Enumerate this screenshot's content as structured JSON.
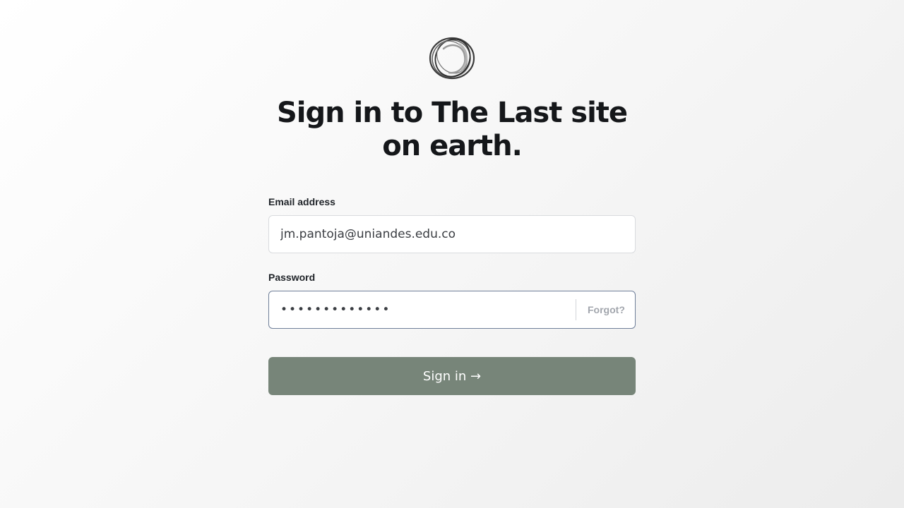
{
  "title": "Sign in to The Last site on earth.",
  "logo_icon": "ring-logo-icon",
  "form": {
    "email_label": "Email address",
    "email_value": "jm.pantoja@uniandes.edu.co",
    "password_label": "Password",
    "password_value": "•••••••••••••",
    "forgot_label": "Forgot?",
    "submit_label": "Sign in →"
  },
  "colors": {
    "button": "#778579",
    "focus_border": "#6f7f99",
    "title": "#15171a"
  }
}
